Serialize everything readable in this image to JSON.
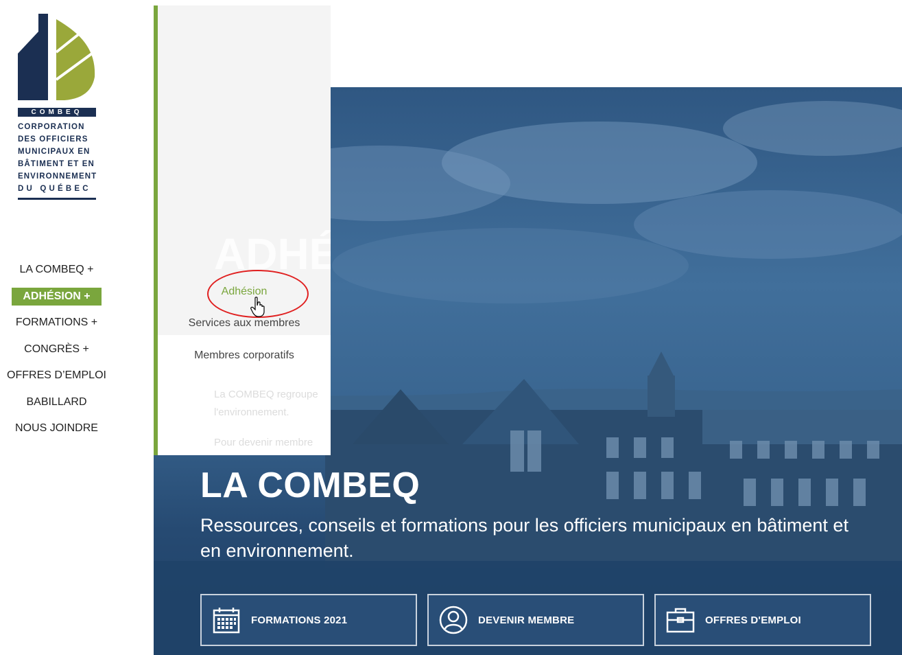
{
  "logo": {
    "band": "COMBEQ",
    "lines": [
      "CORPORATION",
      "DES OFFICIERS",
      "MUNICIPAUX EN",
      "BÂTIMENT ET EN",
      "ENVIRONNEMENT",
      "DU QUÉBEC"
    ]
  },
  "nav": {
    "items": [
      {
        "label": "LA COMBEQ +"
      },
      {
        "label": "ADHÉSION +"
      },
      {
        "label": "FORMATIONS +"
      },
      {
        "label": "CONGRÈS +"
      },
      {
        "label": "OFFRES D’EMPLOI"
      },
      {
        "label": "BABILLARD"
      },
      {
        "label": "NOUS JOINDRE"
      }
    ]
  },
  "dropdown": {
    "ghost_title": "ADHÉ",
    "ghost_text_1": "La COMBEQ regroupe",
    "ghost_text_2": "l'environnement.",
    "ghost_text_3": "Pour devenir membre",
    "items": [
      {
        "label": "Adhésion"
      },
      {
        "label": "Services aux membres"
      },
      {
        "label": "Membres corporatifs"
      }
    ]
  },
  "hero": {
    "title": "LA COMBEQ",
    "subtitle": "Ressources, conseils et formations pour les officiers municipaux en bâtiment et en environnement."
  },
  "cta": [
    {
      "label": "FORMATIONS 2021",
      "icon": "calendar-icon"
    },
    {
      "label": "DEVENIR MEMBRE",
      "icon": "user-circle-icon"
    },
    {
      "label": "OFFRES D'EMPLOI",
      "icon": "briefcase-icon"
    }
  ],
  "colors": {
    "accent": "#7aa63d",
    "navy": "#1b2f52",
    "hero_blue": "#3a6691",
    "annotation": "#e02020"
  }
}
